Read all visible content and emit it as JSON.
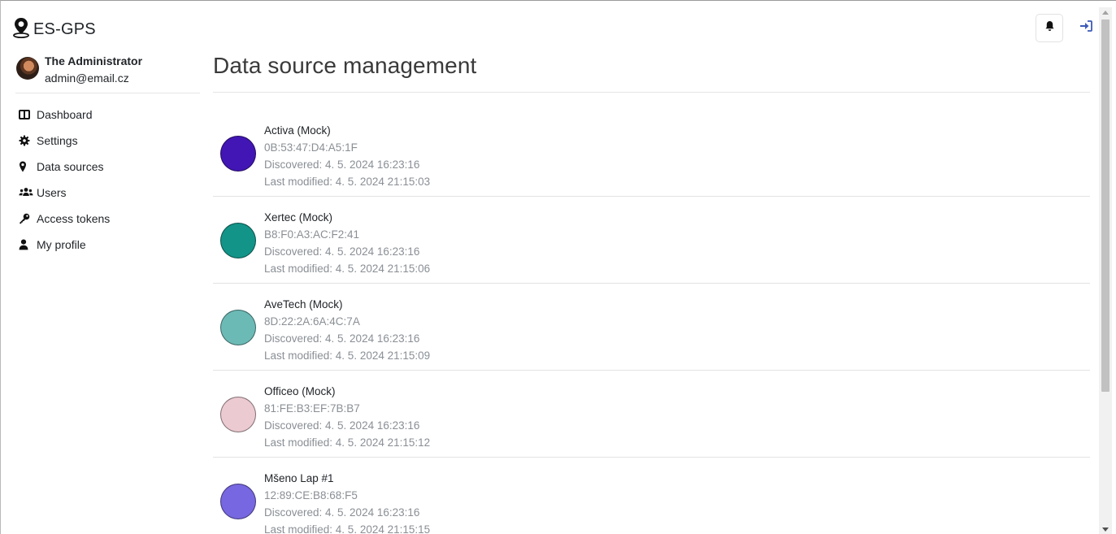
{
  "app": {
    "brand": "ES-GPS"
  },
  "user": {
    "name": "The Administrator",
    "email": "admin@email.cz"
  },
  "sidebar": {
    "items": [
      {
        "label": "Dashboard",
        "icon": "dashboard-icon"
      },
      {
        "label": "Settings",
        "icon": "gear-icon"
      },
      {
        "label": "Data sources",
        "icon": "map-pin-icon"
      },
      {
        "label": "Users",
        "icon": "users-icon"
      },
      {
        "label": "Access tokens",
        "icon": "key-icon"
      },
      {
        "label": "My profile",
        "icon": "user-icon"
      }
    ]
  },
  "header": {
    "notifications_icon": "bell-icon",
    "logout_icon": "sign-out-icon"
  },
  "main": {
    "title": "Data source management",
    "sources": [
      {
        "name": "Activa (Mock)",
        "mac": "0B:53:47:D4:A5:1F",
        "discovered": "Discovered: 4. 5. 2024 16:23:16",
        "modified": "Last modified: 4. 5. 2024 21:15:03",
        "color": "#4216b4"
      },
      {
        "name": "Xertec (Mock)",
        "mac": "B8:F0:A3:AC:F2:41",
        "discovered": "Discovered: 4. 5. 2024 16:23:16",
        "modified": "Last modified: 4. 5. 2024 21:15:06",
        "color": "#139488"
      },
      {
        "name": "AveTech (Mock)",
        "mac": "8D:22:2A:6A:4C:7A",
        "discovered": "Discovered: 4. 5. 2024 16:23:16",
        "modified": "Last modified: 4. 5. 2024 21:15:09",
        "color": "#6cbab6"
      },
      {
        "name": "Officeo (Mock)",
        "mac": "81:FE:B3:EF:7B:B7",
        "discovered": "Discovered: 4. 5. 2024 16:23:16",
        "modified": "Last modified: 4. 5. 2024 21:15:12",
        "color": "#eccad2"
      },
      {
        "name": "Mšeno Lap #1",
        "mac": "12:89:CE:B8:68:F5",
        "discovered": "Discovered: 4. 5. 2024 16:23:16",
        "modified": "Last modified: 4. 5. 2024 21:15:15",
        "color": "#7767e0"
      }
    ]
  },
  "colors": {
    "accent": "#3d5ab8",
    "text": "#212529",
    "muted": "#8a8f95"
  }
}
